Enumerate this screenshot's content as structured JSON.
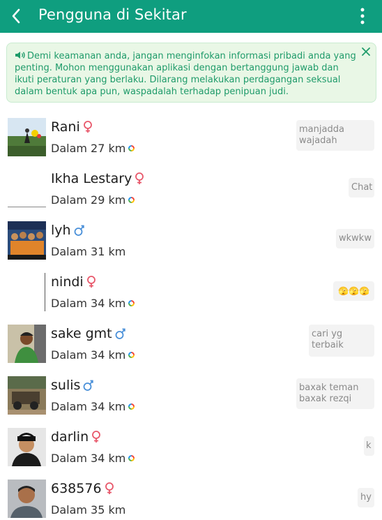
{
  "header": {
    "title": "Pengguna di Sekitar"
  },
  "notice": {
    "text": "Demi keamanan anda, jangan menginfokan informasi pribadi anda yang penting. Mohon menggunakan aplikasi dengan bertanggung jawab dan ikuti peraturan yang berlaku. Dilarang melakukan perdagangan seksual dalam bentuk apa pun, waspadalah terhadap penipuan judi."
  },
  "colors": {
    "header": "#0f9e7f",
    "notice_bg": "#e9f7e6",
    "notice_text": "#1f9b6a",
    "female": "#e8586b",
    "male": "#4a90d9"
  },
  "users": [
    {
      "name": "Rani",
      "gender": "female",
      "distance": "Dalam 27 km",
      "online": true,
      "message": "manjadda wajadah"
    },
    {
      "name": "Ikha Lestary",
      "gender": "female",
      "distance": "Dalam 29 km",
      "online": true,
      "message": "Chat"
    },
    {
      "name": "lyh",
      "gender": "male",
      "distance": "Dalam 31 km",
      "online": false,
      "message": "wkwkw"
    },
    {
      "name": "nindi",
      "gender": "female",
      "distance": "Dalam 34 km",
      "online": true,
      "message": "🫣🫣🫣"
    },
    {
      "name": "sake gmt",
      "gender": "male",
      "distance": "Dalam 34 km",
      "online": true,
      "message": "cari yg terbaik"
    },
    {
      "name": "sulis",
      "gender": "male",
      "distance": "Dalam 34 km",
      "online": true,
      "message": "baxak teman baxak rezqi"
    },
    {
      "name": "darlin",
      "gender": "female",
      "distance": "Dalam 34 km",
      "online": true,
      "message": "k"
    },
    {
      "name": "638576",
      "gender": "female",
      "distance": "Dalam 35 km",
      "online": false,
      "message": "hy"
    }
  ]
}
